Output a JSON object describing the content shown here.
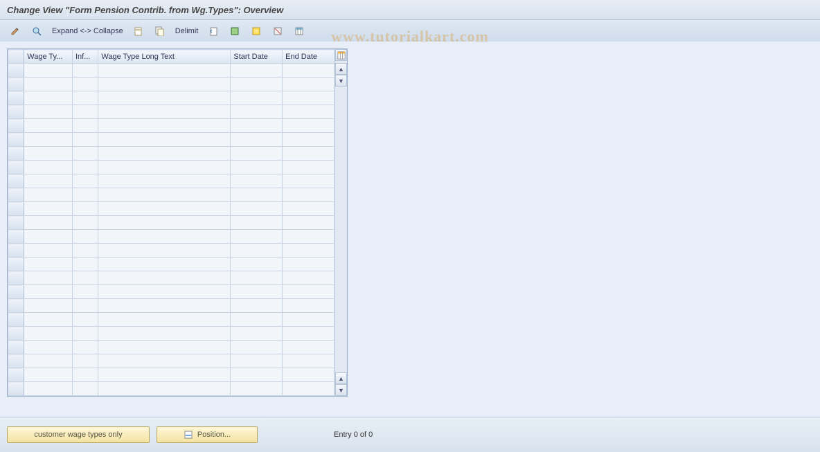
{
  "title": "Change View \"Form Pension Contrib. from Wg.Types\": Overview",
  "watermark": "www.tutorialkart.com",
  "toolbar": {
    "expand_collapse": "Expand <-> Collapse",
    "delimit": "Delimit"
  },
  "table": {
    "columns": {
      "wage_type": "Wage Ty...",
      "infotype": "Inf...",
      "long_text": "Wage Type Long Text",
      "start_date": "Start Date",
      "end_date": "End Date"
    },
    "rows": [
      {},
      {},
      {},
      {},
      {},
      {},
      {},
      {},
      {},
      {},
      {},
      {},
      {},
      {},
      {},
      {},
      {},
      {},
      {},
      {},
      {},
      {},
      {},
      {}
    ]
  },
  "footer": {
    "customer_wt": "customer wage types only",
    "position": "Position...",
    "entry": "Entry 0 of 0"
  }
}
